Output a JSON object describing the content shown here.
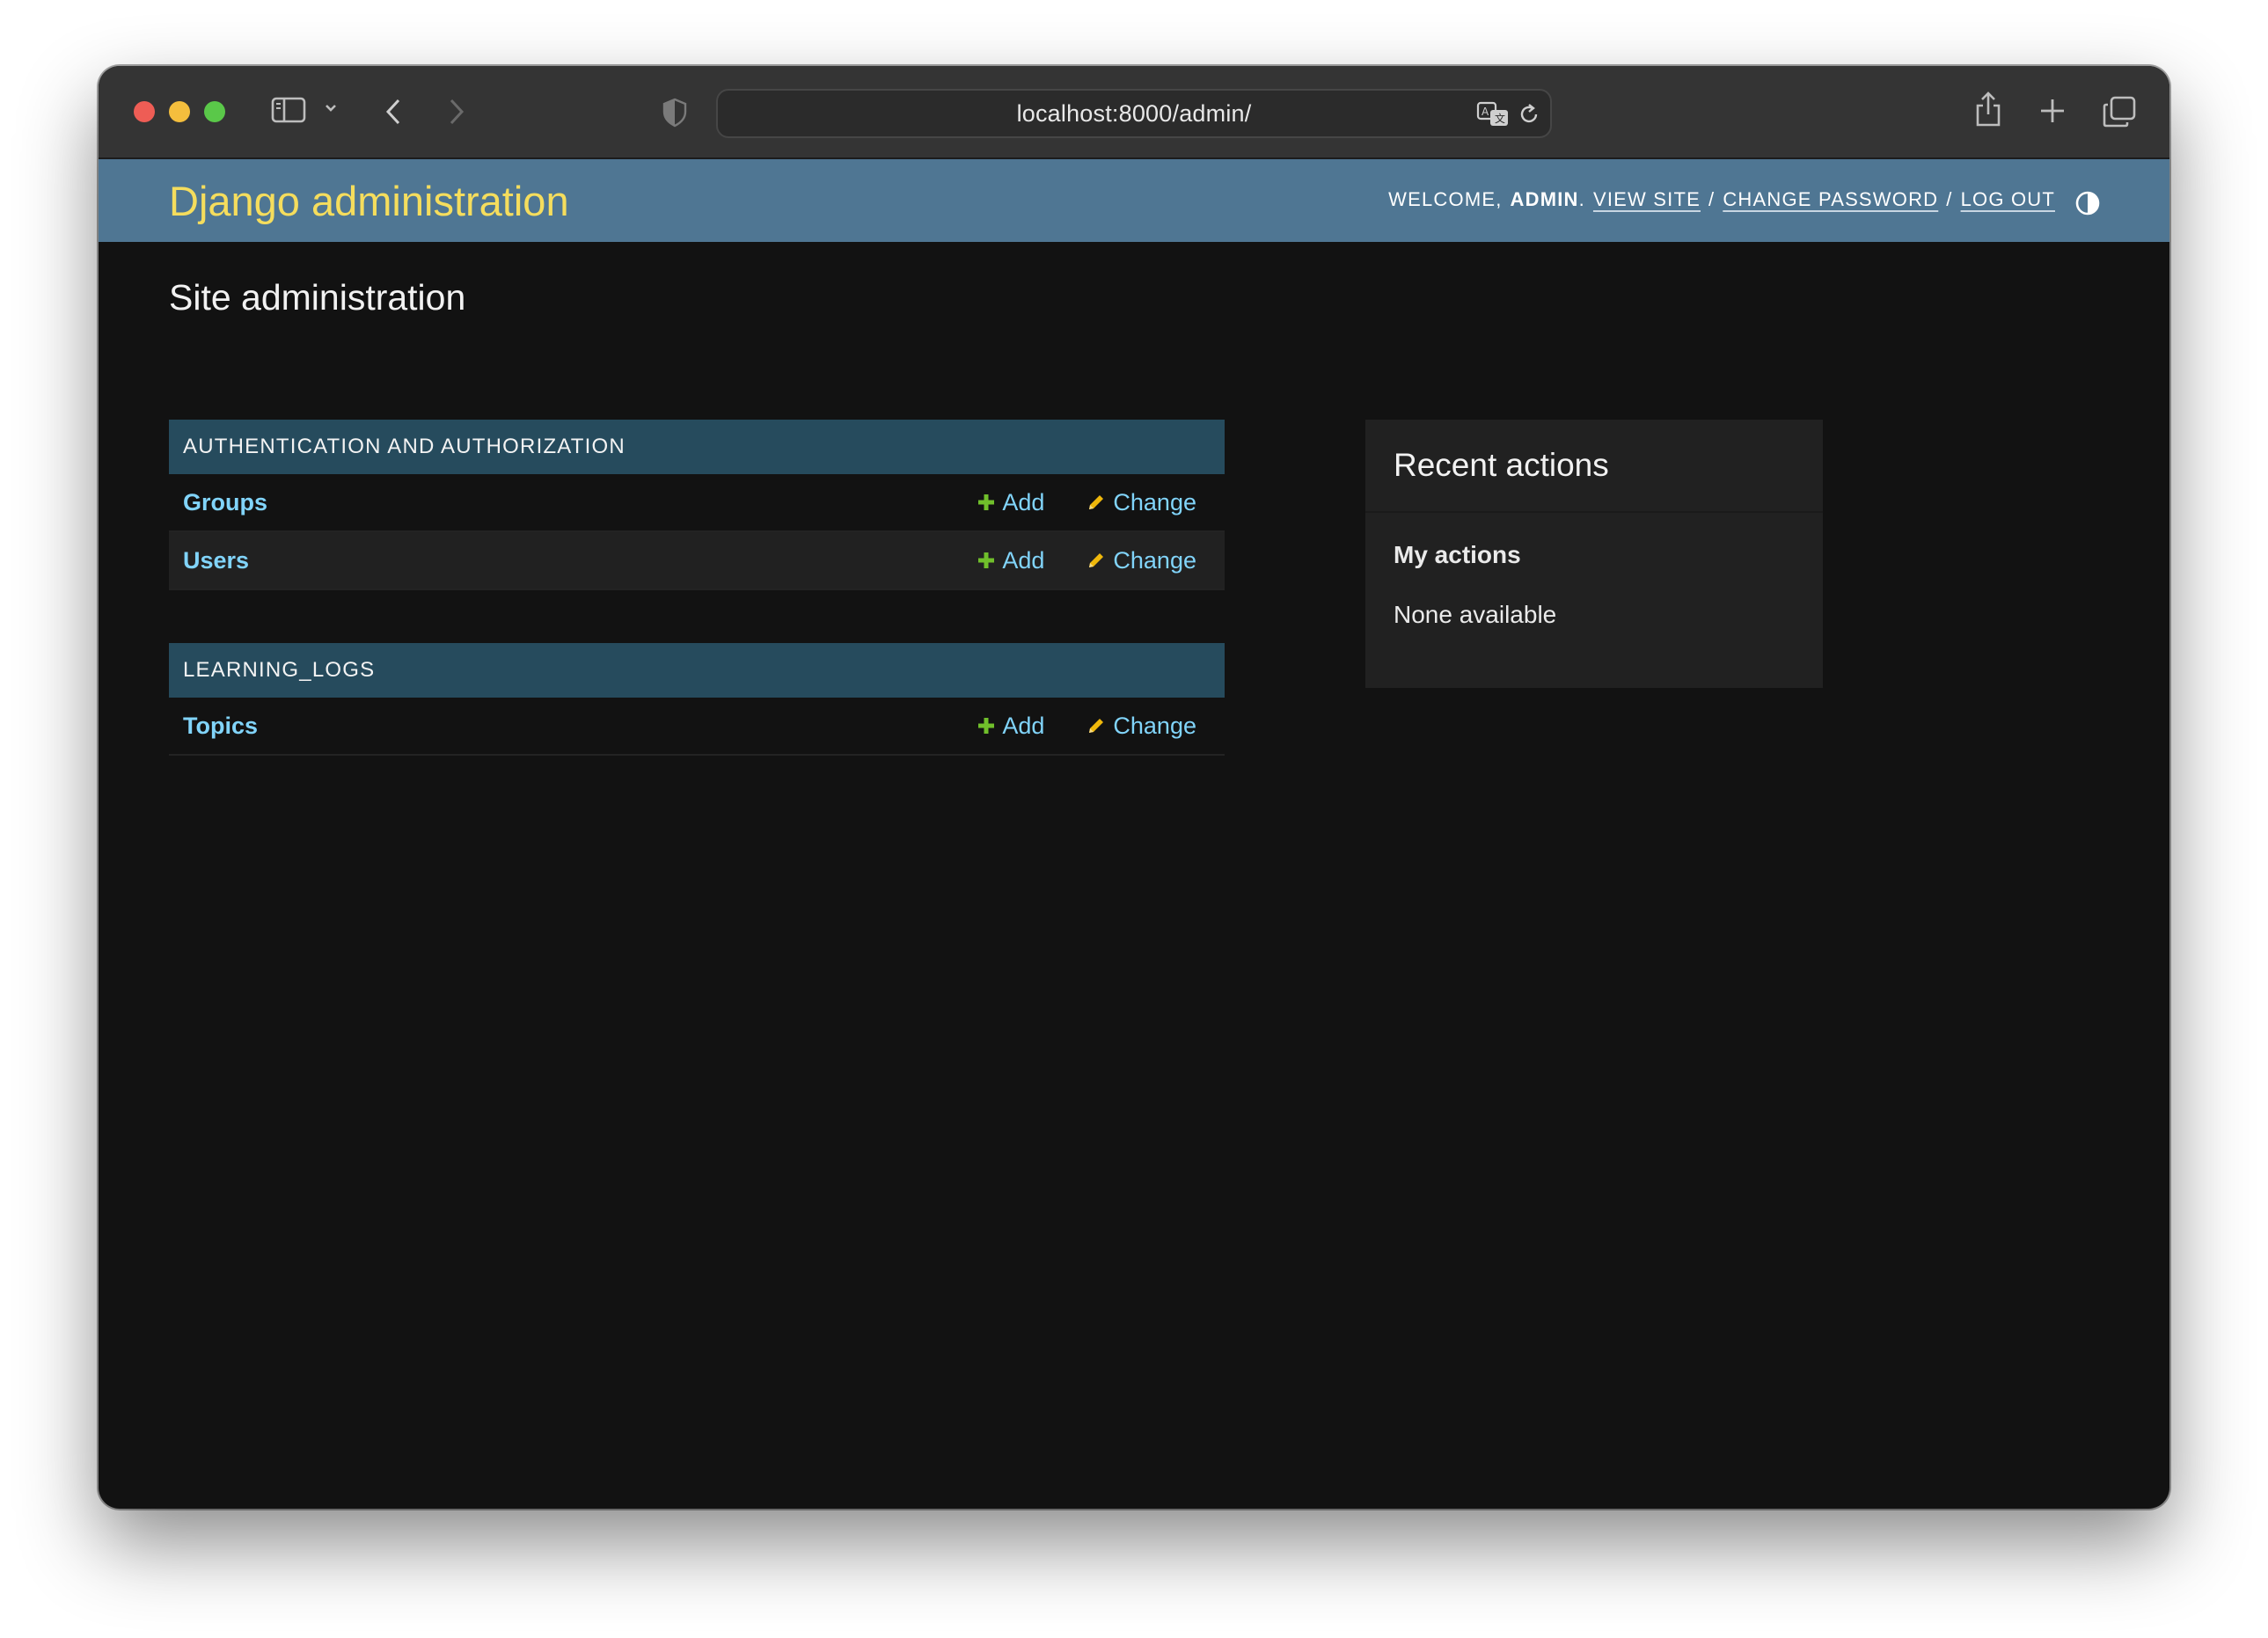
{
  "browser": {
    "url": "localhost:8000/admin/"
  },
  "header": {
    "branding": "Django administration",
    "welcome": "WELCOME,",
    "username": "ADMIN",
    "view_site": "VIEW SITE",
    "change_password": "CHANGE PASSWORD",
    "log_out": "LOG OUT",
    "separator": "/"
  },
  "page": {
    "title": "Site administration"
  },
  "apps": [
    {
      "caption": "AUTHENTICATION AND AUTHORIZATION",
      "models": [
        {
          "name": "Groups",
          "add": "Add",
          "change": "Change"
        },
        {
          "name": "Users",
          "add": "Add",
          "change": "Change"
        }
      ]
    },
    {
      "caption": "LEARNING_LOGS",
      "models": [
        {
          "name": "Topics",
          "add": "Add",
          "change": "Change"
        }
      ]
    }
  ],
  "recent_actions": {
    "title": "Recent actions",
    "subtitle": "My actions",
    "empty": "None available"
  },
  "colors": {
    "header_bg": "#4f7693",
    "branding": "#f5dd5d",
    "module_caption_bg": "#264b5d",
    "link": "#81d4fa",
    "add_icon": "#70bf2b",
    "change_icon": "#efb80b",
    "body_bg": "#121212"
  },
  "icons": {
    "add": "plus-icon",
    "change": "pencil-icon",
    "theme": "theme-toggle-icon"
  }
}
